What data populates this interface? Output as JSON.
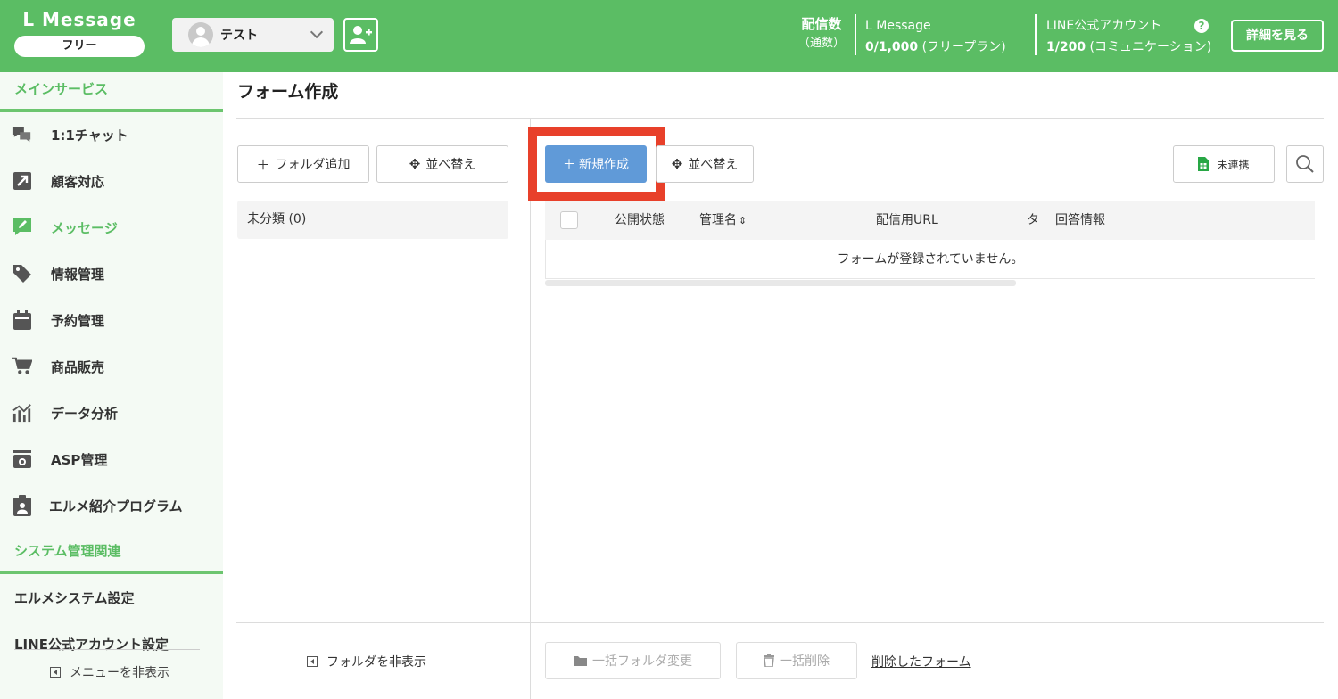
{
  "header": {
    "logo": "L Message",
    "plan": "フリー",
    "account": "テスト",
    "stats_title": "配信数",
    "stats_sub": "（通数）",
    "lmsg_label": "L Message",
    "lmsg_value": "0/1,000",
    "lmsg_plan": "(フリープラン)",
    "line_label": "LINE公式アカウント",
    "line_value": "1/200",
    "line_plan": "(コミュニケーション)",
    "help": "?",
    "detail_button": "詳細を見る"
  },
  "sidebar": {
    "main_section": "メインサービス",
    "items": [
      {
        "label": "1:1チャット",
        "icon": "chat-icon"
      },
      {
        "label": "顧客対応",
        "icon": "arrow-up-right-icon"
      },
      {
        "label": "メッセージ",
        "icon": "message-edit-icon"
      },
      {
        "label": "情報管理",
        "icon": "tag-icon"
      },
      {
        "label": "予約管理",
        "icon": "calendar-icon"
      },
      {
        "label": "商品販売",
        "icon": "cart-icon"
      },
      {
        "label": "データ分析",
        "icon": "chart-icon"
      },
      {
        "label": "ASP管理",
        "icon": "asp-icon"
      },
      {
        "label": "エルメ紹介プログラム",
        "icon": "clipboard-user-icon"
      }
    ],
    "system_section": "システム管理関連",
    "system_items": [
      "エルメシステム設定",
      "LINE公式アカウント設定"
    ],
    "hide_menu": "メニューを非表示"
  },
  "main": {
    "title": "フォーム作成",
    "add_folder": "フォルダ追加",
    "sort": "並べ替え",
    "new_create": "新規作成",
    "sort2": "並べ替え",
    "unlinked": "未連携",
    "folder_uncategorized": "未分類 (0)",
    "table": {
      "col_status": "公開状態",
      "col_name": "管理名",
      "col_url": "配信用URL",
      "col_tag": "タ",
      "col_answers": "回答情報",
      "empty": "フォームが登録されていません。"
    },
    "hide_folder": "フォルダを非表示",
    "bulk_folder_change": "一括フォルダ変更",
    "bulk_delete": "一括削除",
    "deleted_forms": "削除したフォーム"
  },
  "colors": {
    "brand_green": "#5bbd64",
    "primary_blue": "#609ad8",
    "highlight_red": "#e8402a"
  }
}
